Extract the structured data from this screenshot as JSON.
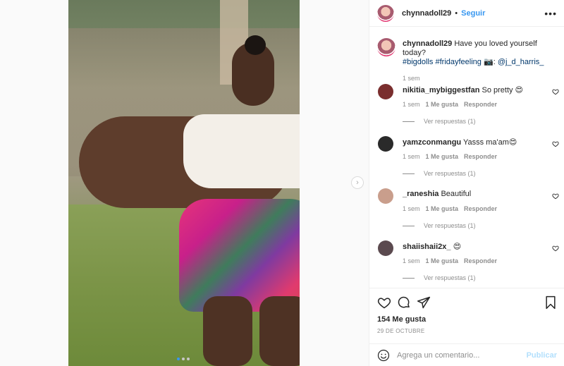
{
  "post": {
    "username": "chynnadoll29",
    "follow_label": "Seguir",
    "header_sep": "•",
    "more_label": "•••"
  },
  "caption": {
    "username": "chynnadoll29",
    "text": "Have you loved yourself today?",
    "hashtags": "#bigdolls #fridayfeeling",
    "emoji": "📷",
    "mention_prefix": ":",
    "mention": "@j_d_harris_",
    "time": "1 sem"
  },
  "comments": [
    {
      "username": "nikitia_mybiggestfan",
      "text": "So pretty 😍",
      "time": "1 sem",
      "likes": "1 Me gusta",
      "reply": "Responder",
      "replies": "Ver respuestas (1)",
      "avatar_color": "#7a2e2e"
    },
    {
      "username": "yamzconmangu",
      "text": "Yasss ma'am😍",
      "time": "1 sem",
      "likes": "1 Me gusta",
      "reply": "Responder",
      "replies": "Ver respuestas (1)",
      "avatar_color": "#2a2a2a"
    },
    {
      "username": "_raneshia",
      "text": "Beautiful",
      "time": "1 sem",
      "likes": "1 Me gusta",
      "reply": "Responder",
      "replies": "Ver respuestas (1)",
      "avatar_color": "#c99e8c"
    },
    {
      "username": "shaiishaii2x_",
      "text": "😍",
      "time": "1 sem",
      "likes": "1 Me gusta",
      "reply": "Responder",
      "replies": "Ver respuestas (1)",
      "avatar_color": "#5b4a4f"
    }
  ],
  "stats": {
    "likes": "154 Me gusta",
    "date": "29 DE OCTUBRE"
  },
  "add_comment": {
    "placeholder": "Agrega un comentario...",
    "publish_label": "Publicar"
  },
  "carousel": {
    "total": 3,
    "active": 1
  },
  "icons": {
    "header_more": "more-options-icon",
    "like": "heart-icon",
    "comment": "comment-icon",
    "share": "share-icon",
    "save": "bookmark-icon",
    "emoji": "emoji-icon",
    "next": "chevron-right-icon"
  },
  "colors": {
    "accent": "#3897f0",
    "muted": "#8e8e8e",
    "publish_disabled": "#b2dffc"
  }
}
